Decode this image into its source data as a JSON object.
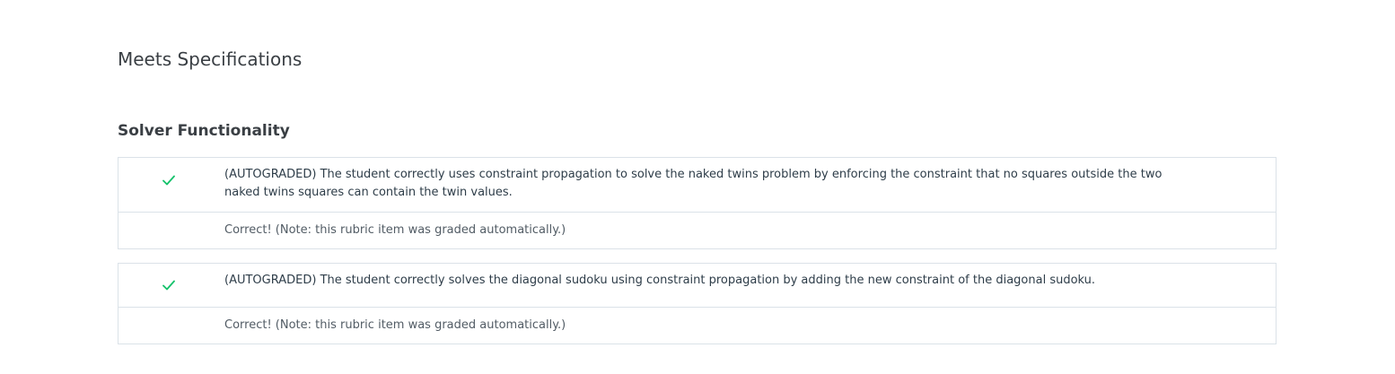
{
  "page": {
    "title": "Meets Specifications"
  },
  "section": {
    "title": "Solver Functionality"
  },
  "colors": {
    "check": "#02b3e4",
    "check_green": "#15c26b",
    "border": "#dbe2e8",
    "text": "#2e3d49"
  },
  "rubric_items": [
    {
      "status_icon": "checkmark-icon",
      "criterion": "(AUTOGRADED) The student correctly uses constraint propagation to solve the naked twins problem by enforcing the constraint that no squares outside the two naked twins squares can contain the twin values.",
      "feedback": "Correct! (Note: this rubric item was graded automatically.)"
    },
    {
      "status_icon": "checkmark-icon",
      "criterion": "(AUTOGRADED) The student correctly solves the diagonal sudoku using constraint propagation by adding the new constraint of the diagonal sudoku.",
      "feedback": "Correct! (Note: this rubric item was graded automatically.)"
    }
  ]
}
